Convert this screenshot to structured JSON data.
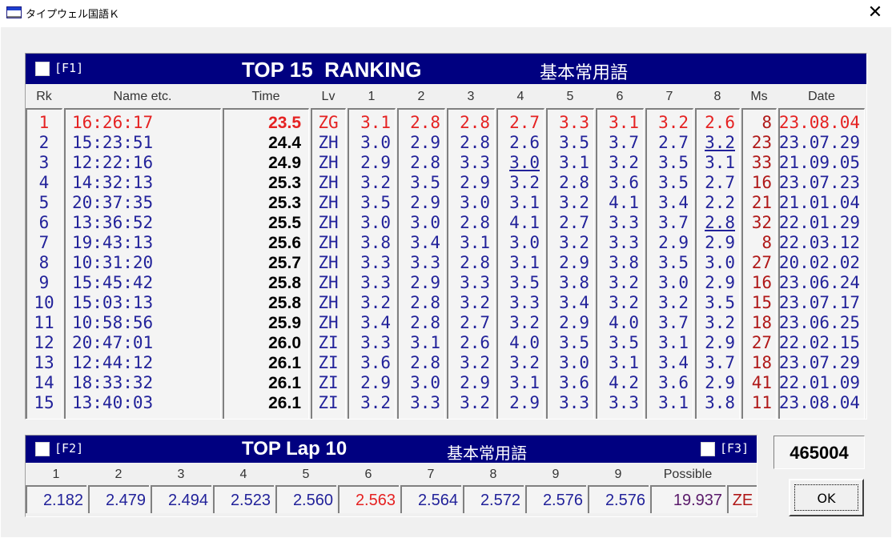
{
  "window": {
    "title": "タイプウェル国語Ｋ",
    "close_glyph": "✕"
  },
  "ranking": {
    "f1_key": "[F1]",
    "title": "TOP 15  RANKING",
    "category": "基本常用語",
    "headers": [
      "Rk",
      "Name etc.",
      "Time",
      "Lv",
      "1",
      "2",
      "3",
      "4",
      "5",
      "6",
      "7",
      "8",
      "Ms",
      "Date"
    ],
    "rows": [
      {
        "rk": "1",
        "name": "16:26:17",
        "time": "23.5",
        "lv": "ZG",
        "laps": [
          "3.1",
          "2.8",
          "2.8",
          "2.7",
          "3.3",
          "3.1",
          "3.2",
          "2.6"
        ],
        "ms": "8",
        "date": "23.08.04"
      },
      {
        "rk": "2",
        "name": "15:23:51",
        "time": "24.4",
        "lv": "ZH",
        "laps": [
          "3.0",
          "2.9",
          "2.8",
          "2.6",
          "3.5",
          "3.7",
          "2.7",
          "3.2"
        ],
        "ms": "23",
        "date": "23.07.29"
      },
      {
        "rk": "3",
        "name": "12:22:16",
        "time": "24.9",
        "lv": "ZH",
        "laps": [
          "2.9",
          "2.8",
          "3.3",
          "3.0",
          "3.1",
          "3.2",
          "3.5",
          "3.1"
        ],
        "ms": "33",
        "date": "21.09.05"
      },
      {
        "rk": "4",
        "name": "14:32:13",
        "time": "25.3",
        "lv": "ZH",
        "laps": [
          "3.2",
          "3.5",
          "2.9",
          "3.2",
          "2.8",
          "3.6",
          "3.5",
          "2.7"
        ],
        "ms": "16",
        "date": "23.07.23"
      },
      {
        "rk": "5",
        "name": "20:37:35",
        "time": "25.3",
        "lv": "ZH",
        "laps": [
          "3.5",
          "2.9",
          "3.0",
          "3.1",
          "3.2",
          "4.1",
          "3.4",
          "2.2"
        ],
        "ms": "21",
        "date": "21.01.04"
      },
      {
        "rk": "6",
        "name": "13:36:52",
        "time": "25.5",
        "lv": "ZH",
        "laps": [
          "3.0",
          "3.0",
          "2.8",
          "4.1",
          "2.7",
          "3.3",
          "3.7",
          "2.8"
        ],
        "ms": "32",
        "date": "22.01.29"
      },
      {
        "rk": "7",
        "name": "19:43:13",
        "time": "25.6",
        "lv": "ZH",
        "laps": [
          "3.8",
          "3.4",
          "3.1",
          "3.0",
          "3.2",
          "3.3",
          "2.9",
          "2.9"
        ],
        "ms": "8",
        "date": "22.03.12"
      },
      {
        "rk": "8",
        "name": "10:31:20",
        "time": "25.7",
        "lv": "ZH",
        "laps": [
          "3.3",
          "3.3",
          "2.8",
          "3.1",
          "2.9",
          "3.8",
          "3.5",
          "3.0"
        ],
        "ms": "27",
        "date": "20.02.02"
      },
      {
        "rk": "9",
        "name": "15:45:42",
        "time": "25.8",
        "lv": "ZH",
        "laps": [
          "3.3",
          "2.9",
          "3.3",
          "3.5",
          "3.8",
          "3.2",
          "3.0",
          "2.9"
        ],
        "ms": "16",
        "date": "23.06.24"
      },
      {
        "rk": "10",
        "name": "15:03:13",
        "time": "25.8",
        "lv": "ZH",
        "laps": [
          "3.2",
          "2.8",
          "3.2",
          "3.3",
          "3.4",
          "3.2",
          "3.2",
          "3.5"
        ],
        "ms": "15",
        "date": "23.07.17"
      },
      {
        "rk": "11",
        "name": "10:58:56",
        "time": "25.9",
        "lv": "ZH",
        "laps": [
          "3.4",
          "2.8",
          "2.7",
          "3.2",
          "2.9",
          "4.0",
          "3.7",
          "3.2"
        ],
        "ms": "18",
        "date": "23.06.25"
      },
      {
        "rk": "12",
        "name": "20:47:01",
        "time": "26.0",
        "lv": "ZI",
        "laps": [
          "3.3",
          "3.1",
          "2.6",
          "4.0",
          "3.5",
          "3.5",
          "3.1",
          "2.9"
        ],
        "ms": "27",
        "date": "22.02.15"
      },
      {
        "rk": "13",
        "name": "12:44:12",
        "time": "26.1",
        "lv": "ZI",
        "laps": [
          "3.6",
          "2.8",
          "3.2",
          "3.2",
          "3.0",
          "3.1",
          "3.4",
          "3.7"
        ],
        "ms": "18",
        "date": "23.07.29"
      },
      {
        "rk": "14",
        "name": "18:33:32",
        "time": "26.1",
        "lv": "ZI",
        "laps": [
          "2.9",
          "3.0",
          "2.9",
          "3.1",
          "3.6",
          "4.2",
          "3.6",
          "2.9"
        ],
        "ms": "41",
        "date": "22.01.09"
      },
      {
        "rk": "15",
        "name": "13:40:03",
        "time": "26.1",
        "lv": "ZI",
        "laps": [
          "3.2",
          "3.3",
          "3.2",
          "2.9",
          "3.3",
          "3.3",
          "3.1",
          "3.8"
        ],
        "ms": "11",
        "date": "23.08.04"
      }
    ],
    "underlined": [
      [
        1,
        7
      ],
      [
        2,
        3
      ],
      [
        5,
        7
      ]
    ]
  },
  "laps": {
    "f2_key": "[F2]",
    "f3_key": "[F3]",
    "title": "TOP Lap 10",
    "category": "基本常用語",
    "headers": [
      "1",
      "2",
      "3",
      "4",
      "5",
      "6",
      "7",
      "8",
      "9",
      "9",
      "Possible"
    ],
    "values": [
      "2.182",
      "2.479",
      "2.494",
      "2.523",
      "2.560",
      "2.563",
      "2.564",
      "2.572",
      "2.576",
      "2.576",
      "19.937"
    ],
    "level": "ZE"
  },
  "score": "465004",
  "ok_label": "OK",
  "colors": {
    "header_bg": "#000080",
    "text_blue": "#22229a",
    "text_red": "#e52222",
    "text_darkred": "#b01818"
  }
}
